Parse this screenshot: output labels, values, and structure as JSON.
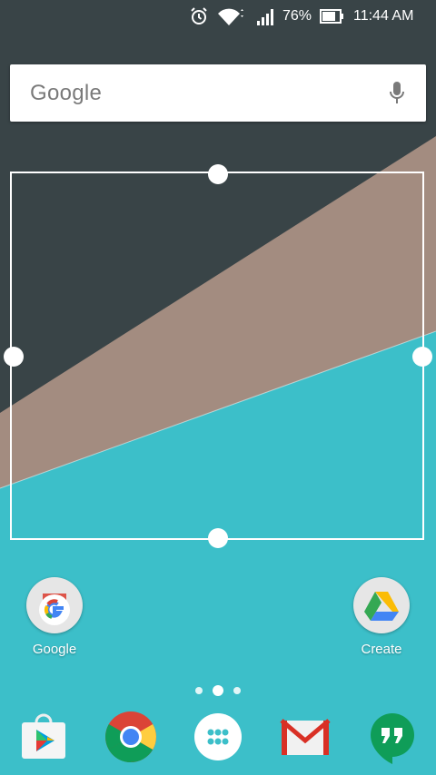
{
  "status_bar": {
    "battery_percent": "76%",
    "time": "11:44 AM",
    "icons": [
      "alarm-icon",
      "wifi-icon",
      "signal-icon",
      "battery-icon"
    ]
  },
  "search_widget": {
    "logo_text": "Google",
    "mic_icon": "mic-icon"
  },
  "resize_frame": {
    "handles": [
      "top",
      "left",
      "right",
      "bottom"
    ]
  },
  "home_apps": [
    {
      "label": "Google",
      "icon": "google-icon"
    },
    {
      "label": "Create",
      "icon": "drive-icon"
    }
  ],
  "page_indicator": {
    "pages": 3,
    "current": 2
  },
  "dock": [
    {
      "app": "Play Store",
      "icon": "play-store-icon"
    },
    {
      "app": "Chrome",
      "icon": "chrome-icon"
    },
    {
      "app": "All apps",
      "icon": "app-drawer-icon"
    },
    {
      "app": "Gmail",
      "icon": "gmail-icon"
    },
    {
      "app": "Hangouts",
      "icon": "hangouts-icon"
    }
  ],
  "colors": {
    "wallpaper_dark": "#394447",
    "wallpaper_tan": "#a38c80",
    "wallpaper_teal": "#3cbfc9"
  }
}
